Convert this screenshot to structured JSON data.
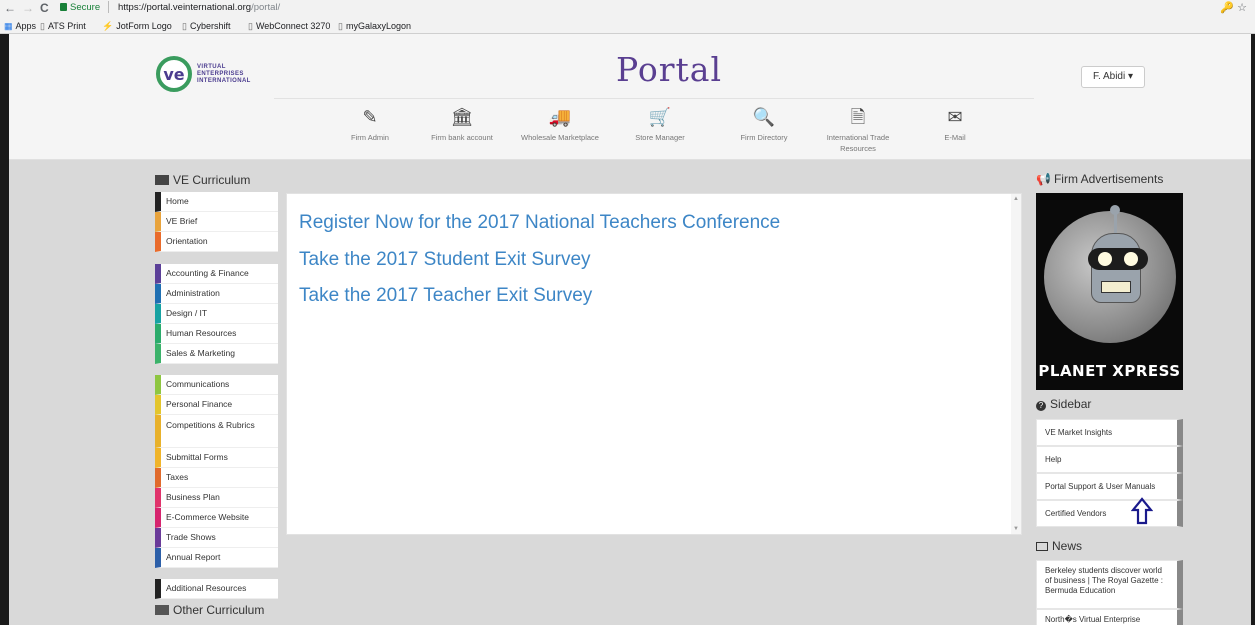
{
  "browser": {
    "back": "←",
    "forward": "→",
    "reload": "C",
    "secure_label": "Secure",
    "url_base": "https://portal.veinternational.org",
    "url_path": "/portal/",
    "ext_icons": "🔑 ☆",
    "bookmarks": [
      {
        "label": "Apps",
        "icon": "apps-icon"
      },
      {
        "label": "ATS Print",
        "icon": "page-icon"
      },
      {
        "label": "JotForm Logo",
        "icon": "jotform-icon"
      },
      {
        "label": "Cybershift",
        "icon": "page-icon"
      },
      {
        "label": "WebConnect 3270",
        "icon": "page-icon"
      },
      {
        "label": "myGalaxyLogon",
        "icon": "page-icon"
      }
    ]
  },
  "header": {
    "logo_letters": "ve",
    "logo_line1": "VIRTUAL",
    "logo_line2": "ENTERPRISES",
    "logo_line3": "INTERNATIONAL",
    "title": "Portal",
    "user_menu": "F. Abidi ▾",
    "nav": [
      {
        "label": "Firm Admin",
        "icon": "edit-icon",
        "glyph": "✎"
      },
      {
        "label": "Firm bank account",
        "icon": "bank-icon",
        "glyph": "🏛"
      },
      {
        "label": "Wholesale Marketplace",
        "icon": "truck-icon",
        "glyph": "🚚"
      },
      {
        "label": "Store Manager",
        "icon": "cart-icon",
        "glyph": "🛒"
      },
      {
        "label": "Firm Directory",
        "icon": "search-icon",
        "glyph": "🔍"
      },
      {
        "label": "International Trade Resources",
        "icon": "document-icon",
        "glyph": "🗎"
      },
      {
        "label": "E-Mail",
        "icon": "envelope-icon",
        "glyph": "✉"
      }
    ]
  },
  "left": {
    "title": "VE Curriculum",
    "group1": [
      {
        "label": "Home",
        "color": "#222222"
      },
      {
        "label": "VE Brief",
        "color": "#e8a33c"
      },
      {
        "label": "Orientation",
        "color": "#e96b2b"
      }
    ],
    "group2": [
      {
        "label": "Accounting & Finance",
        "color": "#5b3f98"
      },
      {
        "label": "Administration",
        "color": "#1f6fb2"
      },
      {
        "label": "Design / IT",
        "color": "#17a2a2"
      },
      {
        "label": "Human Resources",
        "color": "#2bab6b"
      },
      {
        "label": "Sales & Marketing",
        "color": "#3bb26a"
      }
    ],
    "group3": [
      {
        "label": "Communications",
        "color": "#8ec641"
      },
      {
        "label": "Personal Finance",
        "color": "#e3c52c"
      },
      {
        "label": "Competitions & Rubrics",
        "color": "#e8b12b"
      },
      {
        "label": "Submittal Forms",
        "color": "#f0b429"
      },
      {
        "label": "Taxes",
        "color": "#e06a2b"
      },
      {
        "label": "Business Plan",
        "color": "#e0336b"
      },
      {
        "label": "E-Commerce Website",
        "color": "#d6246e"
      },
      {
        "label": "Trade Shows",
        "color": "#6a3a99"
      },
      {
        "label": "Annual Report",
        "color": "#2c5fa8"
      }
    ],
    "group4": [
      {
        "label": "Additional Resources",
        "color": "#222222"
      }
    ],
    "other_title": "Other Curriculum"
  },
  "main": {
    "links": [
      "Register Now for the 2017 National Teachers Conference",
      "Take the 2017 Student Exit Survey",
      "Take the 2017 Teacher Exit Survey"
    ]
  },
  "right": {
    "ads_title": "Firm Advertisements",
    "ad_caption": "PLANET XPRESS",
    "sidebar_title": "Sidebar",
    "sidebar_items": [
      "VE Market Insights",
      "Help",
      "Portal Support & User Manuals",
      "Certified Vendors"
    ],
    "news_title": "News",
    "news_items": [
      "Berkeley students discover world of business | The Royal Gazette : Bermuda Education",
      "North�s Virtual Enterprise"
    ]
  }
}
